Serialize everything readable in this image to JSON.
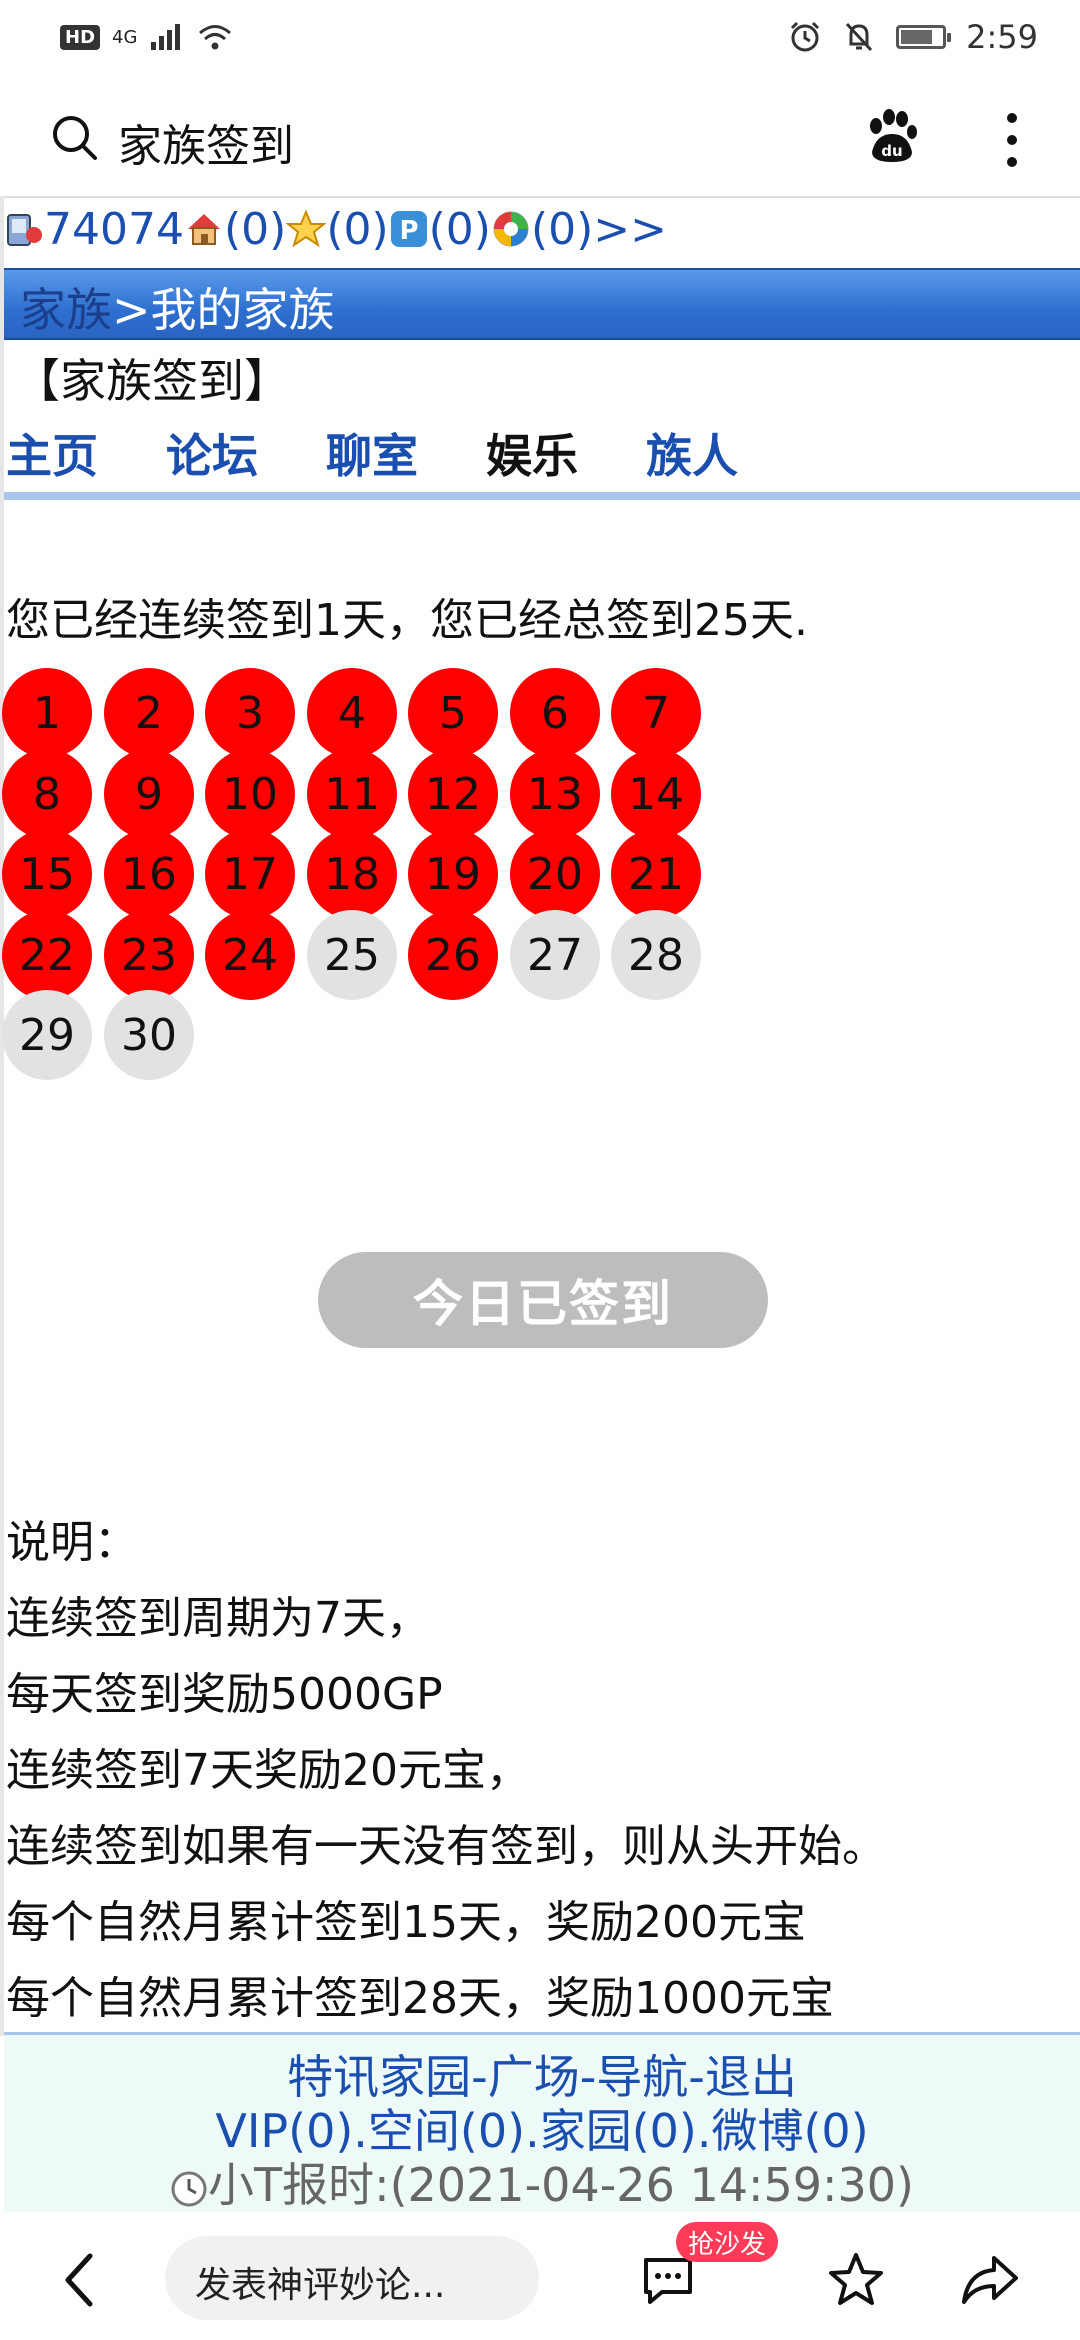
{
  "status_bar": {
    "network": "4G",
    "time": "2:59"
  },
  "top_bar": {
    "title": "家族签到"
  },
  "counters": {
    "user_id": "74074",
    "home": "(0)",
    "star": "(0)",
    "p": "(0)",
    "ball": "(0)",
    "more": ">>"
  },
  "breadcrumb": {
    "family_link": "家族",
    "separator": ">",
    "current": "我的家族"
  },
  "page_heading": "【家族签到】",
  "tabs": [
    {
      "label": "主页"
    },
    {
      "label": "论坛"
    },
    {
      "label": "聊室"
    },
    {
      "label": "娱乐"
    },
    {
      "label": "族人"
    }
  ],
  "streak_text": "您已经连续签到1天，您已经总签到25天.",
  "days": [
    {
      "label": "1",
      "signed": true
    },
    {
      "label": "2",
      "signed": true
    },
    {
      "label": "3",
      "signed": true
    },
    {
      "label": "4",
      "signed": true
    },
    {
      "label": "5",
      "signed": true
    },
    {
      "label": "6",
      "signed": true
    },
    {
      "label": "7",
      "signed": true
    },
    {
      "label": "8",
      "signed": true
    },
    {
      "label": "9",
      "signed": true
    },
    {
      "label": "10",
      "signed": true
    },
    {
      "label": "11",
      "signed": true
    },
    {
      "label": "12",
      "signed": true
    },
    {
      "label": "13",
      "signed": true
    },
    {
      "label": "14",
      "signed": true
    },
    {
      "label": "15",
      "signed": true
    },
    {
      "label": "16",
      "signed": true
    },
    {
      "label": "17",
      "signed": true
    },
    {
      "label": "18",
      "signed": true
    },
    {
      "label": "19",
      "signed": true
    },
    {
      "label": "20",
      "signed": true
    },
    {
      "label": "21",
      "signed": true
    },
    {
      "label": "22",
      "signed": true
    },
    {
      "label": "23",
      "signed": true
    },
    {
      "label": "24",
      "signed": true
    },
    {
      "label": "25",
      "signed": false
    },
    {
      "label": "26",
      "signed": true
    },
    {
      "label": "27",
      "signed": false
    },
    {
      "label": "28",
      "signed": false
    },
    {
      "label": "29",
      "signed": false
    },
    {
      "label": "30",
      "signed": false
    }
  ],
  "signed_button_label": "今日已签到",
  "rules": [
    "说明：",
    "连续签到周期为7天，",
    "每天签到奖励5000GP",
    "连续签到7天奖励20元宝，",
    "连续签到如果有一天没有签到，则从头开始。",
    "每个自然月累计签到15天，奖励200元宝",
    "每个自然月累计签到28天，奖励1000元宝"
  ],
  "footer": {
    "nav_1": "特讯家园",
    "sep_1": "-",
    "nav_2": "广场",
    "sep_2": "-",
    "nav_3": "导航",
    "sep_3": "-",
    "nav_4": "退出",
    "vip": "VIP(0)",
    "space": ".空间(0)",
    "home": ".家园(0)",
    "weibo": ".微博(0)",
    "time_report": "小T报时:(2021-04-26 14:59:30)"
  },
  "bottom_bar": {
    "comment_placeholder": "发表神评妙论...",
    "sofa_badge": "抢沙发"
  },
  "colors": {
    "signed_day": "#ff0000",
    "unsigned_day": "#e2e2e2",
    "link_blue": "#1a4fb0",
    "header_blue": "#2d6fd1",
    "badge_red": "#ff3b57"
  }
}
